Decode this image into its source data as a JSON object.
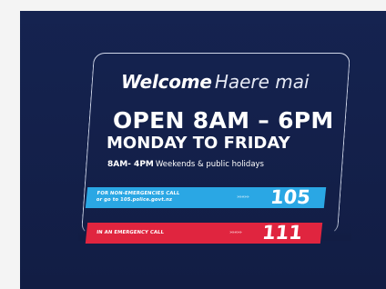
{
  "sign": {
    "background": "#14204a",
    "welcome": "Welcome",
    "welcome_maori": "Haere mai",
    "hours": "OPEN 8AM – 6PM",
    "days": "MONDAY TO FRIDAY",
    "weekend_time": "8AM- 4PM",
    "weekend_days": "Weekends & public holidays"
  },
  "non_emergency": {
    "label_line1": "FOR NON-EMERGENCIES CALL",
    "label_line2": "or go to 105.police.govt.nz",
    "arrows": "»»»»»",
    "number": "105",
    "color": "#2aa7e4"
  },
  "emergency": {
    "label": "IN AN EMERGENCY CALL",
    "arrows": "»»»»»",
    "number": "111",
    "color": "#e0253f"
  }
}
